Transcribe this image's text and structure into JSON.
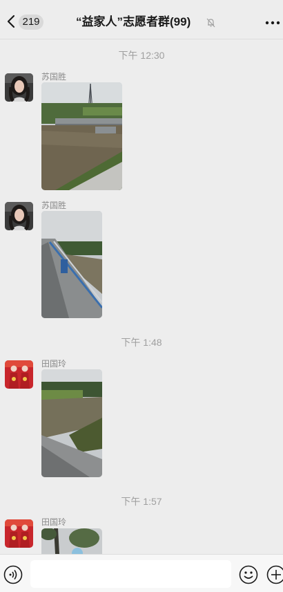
{
  "header": {
    "unread_count": "219",
    "title": "“益家人”志愿者群(99)",
    "icons": {
      "back": "chevron-left-icon",
      "mute": "bell-muted-icon",
      "more": "more-dots-icon"
    }
  },
  "messages": [
    {
      "type": "timestamp",
      "text": "下午 12:30"
    },
    {
      "type": "image",
      "sender": "苏国胜",
      "avatar": "woman-portrait-avatar"
    },
    {
      "type": "image",
      "sender": "苏国胜",
      "avatar": "woman-portrait-avatar"
    },
    {
      "type": "timestamp",
      "text": "下午 1:48"
    },
    {
      "type": "image",
      "sender": "田国玲",
      "avatar": "couple-red-avatar"
    },
    {
      "type": "timestamp",
      "text": "下午 1:57"
    },
    {
      "type": "image",
      "sender": "田国玲",
      "avatar": "couple-red-avatar"
    }
  ],
  "input_bar": {
    "message_value": "",
    "icons": {
      "voice": "voice-icon",
      "emoji": "emoji-icon",
      "plus": "plus-icon"
    }
  },
  "colors": {
    "background": "#ededed",
    "input_bar": "#f7f7f7"
  }
}
